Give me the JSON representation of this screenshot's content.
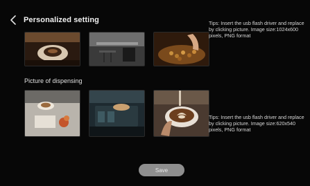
{
  "header": {
    "title": "Personalized setting",
    "back_icon": "chevron-left-icon"
  },
  "section_dispensing": {
    "title": "Picture of dispensing"
  },
  "tips": {
    "top": "Tips: Insert the usb flash driver and replace by clicking picture. Image size:1024x600 pixels, PNG format",
    "bottom": "Tips: Insert the usb flash driver and replace by clicking picture. Image size:620x540 pixels, PNG format"
  },
  "save_label": "Save"
}
